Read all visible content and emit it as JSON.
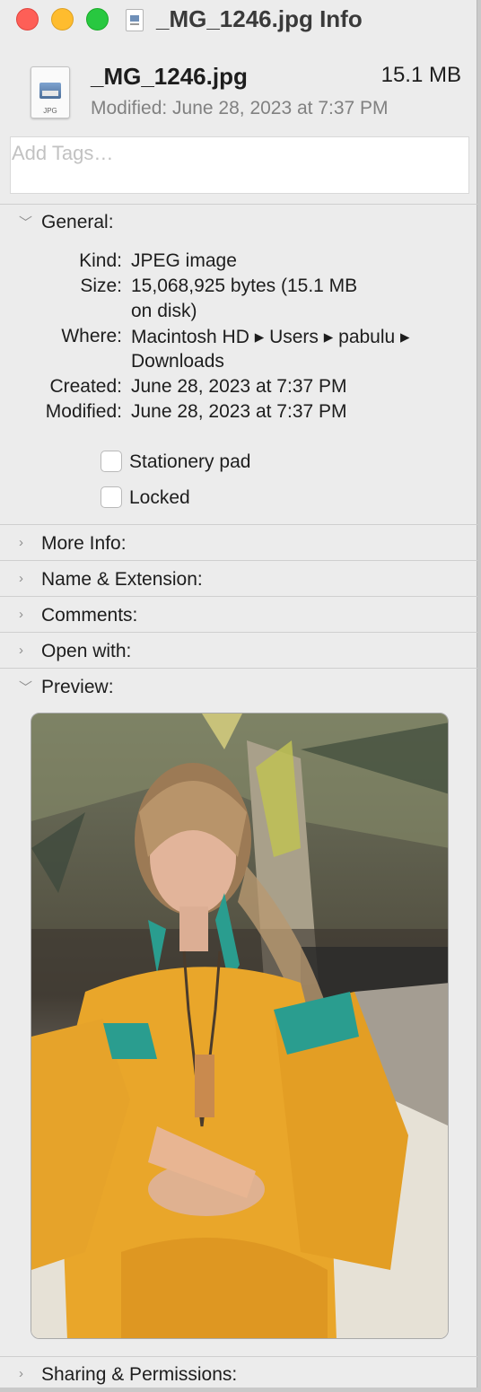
{
  "window": {
    "title": "_MG_1246.jpg Info",
    "icons": {
      "close": "close-dot",
      "minimize": "minimize-dot",
      "zoom": "zoom-dot",
      "proxy": "jpeg-document-icon"
    }
  },
  "file": {
    "name": "_MG_1246.jpg",
    "size": "15.1 MB",
    "modified": "Modified: June 28, 2023 at 7:37 PM",
    "icon_label": "JPG"
  },
  "tags": {
    "placeholder": "Add Tags…",
    "value": ""
  },
  "sections": {
    "general": "General:",
    "more_info": "More Info:",
    "name_extension": "Name & Extension:",
    "comments": "Comments:",
    "open_with": "Open with:",
    "preview": "Preview:",
    "sharing": "Sharing & Permissions:"
  },
  "general": {
    "kind_label": "Kind:",
    "kind_value": "JPEG image",
    "size_label": "Size:",
    "size_value_1": "15,068,925 bytes (15.1 MB",
    "size_value_2": "on disk)",
    "where_label": "Where:",
    "where_value_1": "Macintosh HD ▸ Users ▸ pabulu ▸",
    "where_value_2": "Downloads",
    "created_label": "Created:",
    "created_value": "June 28, 2023 at 7:37 PM",
    "modified_label": "Modified:",
    "modified_value": "June 28, 2023 at 7:37 PM"
  },
  "options": {
    "stationery_label": "Stationery pad",
    "stationery_checked": false,
    "locked_label": "Locked",
    "locked_checked": false
  },
  "colors": {
    "window_bg": "#ececec",
    "close": "#fe5f57",
    "minimize": "#febc2e",
    "zoom": "#28c840",
    "dress": "#e9a62a",
    "embroidery": "#2a9d8f"
  }
}
